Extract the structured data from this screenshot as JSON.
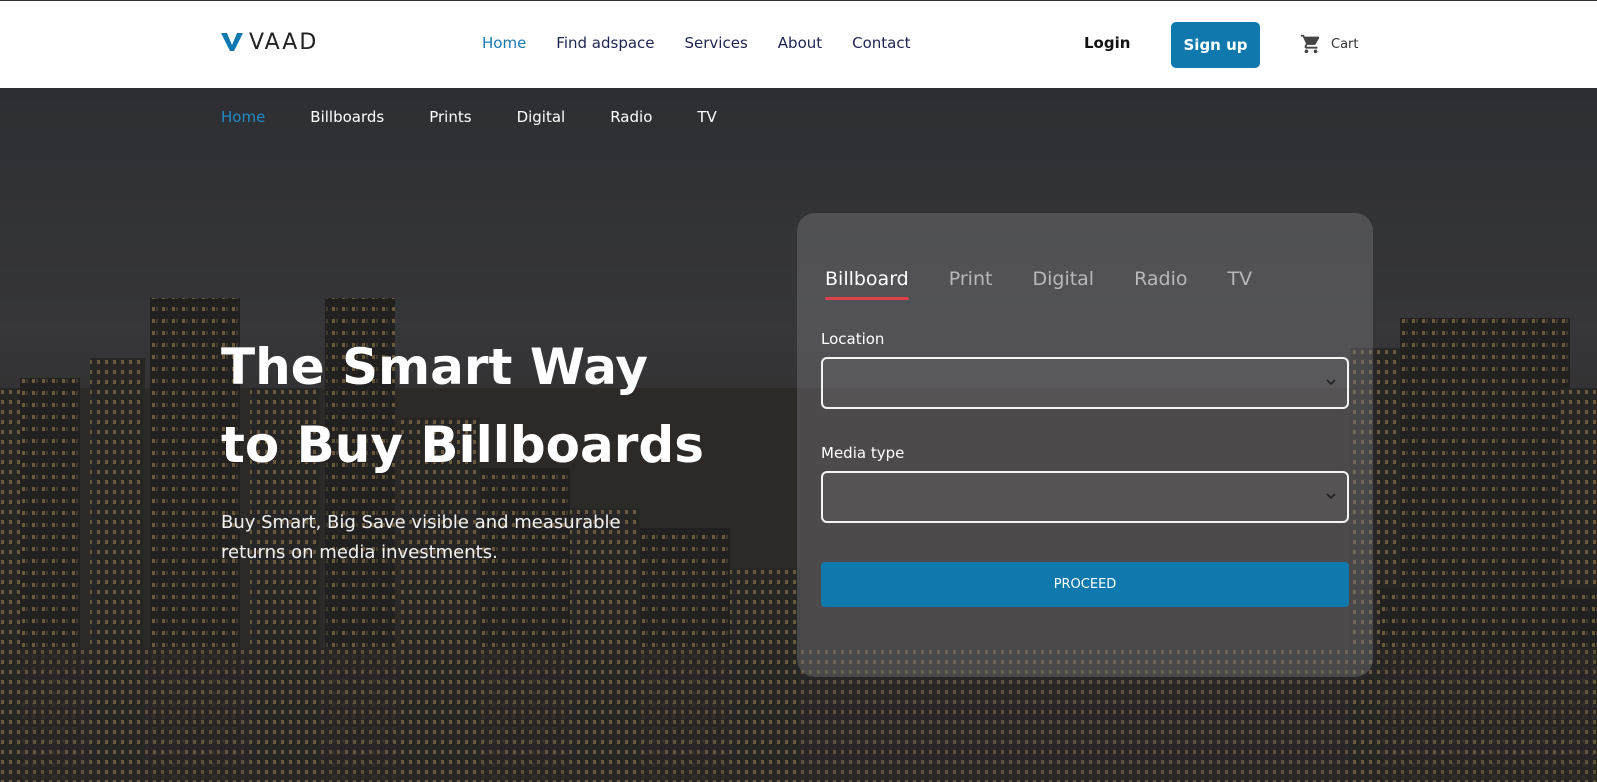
{
  "brand": {
    "name": "VAAD",
    "accent": "#0f79ae"
  },
  "header": {
    "nav": [
      {
        "label": "Home",
        "active": true
      },
      {
        "label": "Find adspace"
      },
      {
        "label": "Services"
      },
      {
        "label": "About"
      },
      {
        "label": "Contact"
      }
    ],
    "login_label": "Login",
    "signup_label": "Sign up",
    "cart_icon": "cart-icon",
    "cart_label": "Cart"
  },
  "sub_nav": [
    {
      "label": "Home",
      "active": true
    },
    {
      "label": "Billboards"
    },
    {
      "label": "Prints"
    },
    {
      "label": "Digital"
    },
    {
      "label": "Radio"
    },
    {
      "label": "TV"
    }
  ],
  "hero": {
    "title_line1": "The Smart Way",
    "title_line2": "to Buy Billboards",
    "subtitle": "Buy Smart, Big Save visible and measurable returns on media investments."
  },
  "form": {
    "tabs": [
      {
        "label": "Billboard",
        "active": true
      },
      {
        "label": "Print"
      },
      {
        "label": "Digital"
      },
      {
        "label": "Radio"
      },
      {
        "label": "TV"
      }
    ],
    "location_label": "Location",
    "location_value": "",
    "media_type_label": "Media type",
    "media_type_value": "",
    "proceed_label": "PROCEED",
    "tab_underline_color": "#e0404a"
  }
}
